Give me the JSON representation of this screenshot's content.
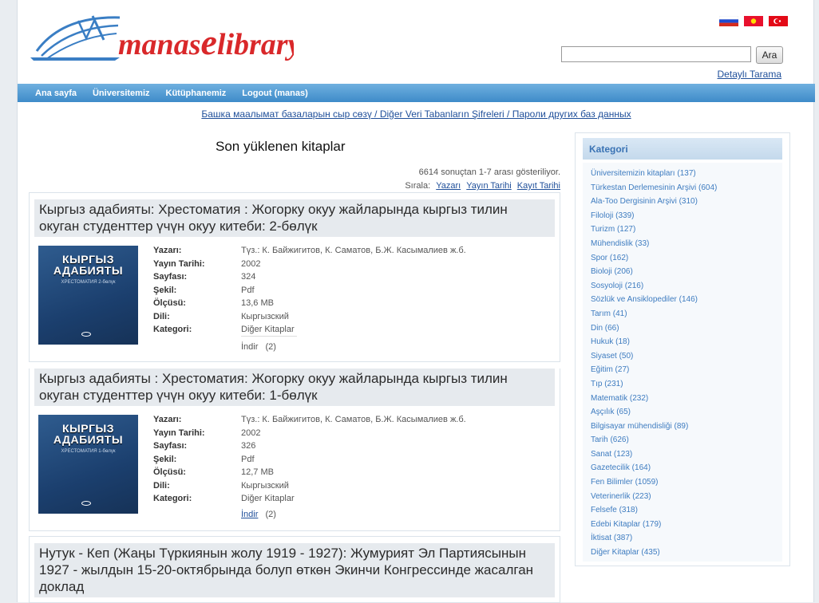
{
  "header": {
    "logo_word_a": "manas",
    "logo_word_b": "e",
    "logo_word_c": "library",
    "flags": [
      {
        "name": "russian-flag-icon",
        "colors": [
          "#ffffff",
          "#1f4bd1",
          "#d52b1e"
        ]
      },
      {
        "name": "kyrgyz-flag-icon",
        "colors": [
          "#e8112d",
          "#ffdf00"
        ]
      },
      {
        "name": "turkish-flag-icon",
        "colors": [
          "#e30a17",
          "#ffffff"
        ]
      }
    ],
    "search": {
      "value": "",
      "button": "Ara"
    },
    "advanced_search": "Detaylı Tarama"
  },
  "nav": {
    "items": [
      "Ana sayfa",
      "Üniversitemiz",
      "Kütüphanemiz",
      "Logout (manas)"
    ]
  },
  "db_link": "Башка маалымат базаларын сыр сөзү / Diğer Veri Tabanların Şifreleri / Пароли других баз данных",
  "main": {
    "section_title": "Son yüklenen kitaplar",
    "results_summary": "6614 sonuçtan 1-7 arası gösteriliyor.",
    "sort_label": "Sırala:",
    "sort_options": [
      "Yazarı",
      "Yayın Tarihi",
      "Kayıt Tarihi"
    ],
    "labels": {
      "author": "Yazarı:",
      "year": "Yayın Tarihi:",
      "pages": "Sayfası:",
      "format": "Şekil:",
      "size": "Ölçüsü:",
      "language": "Dili:",
      "category": "Kategori:"
    },
    "books": [
      {
        "title": "Кыргыз адабияты: Хрестоматия : Жогорку окуу жайларында кыргыз тилин окуган студенттер үчүн окуу китеби: 2-бөлүк",
        "cover_title": "КЫРГЫЗ АДАБИЯТЫ",
        "cover_subtitle": "ХРЕСТОМАТИЯ 2-бөлүк",
        "author": "Түз.: К. Байжигитов, К. Саматов, Б.Ж. Касымалиев ж.б.",
        "year": "2002",
        "pages": "324",
        "format": "Pdf",
        "size": "13,6 MB",
        "language": "Кыргызский",
        "category": "Diğer Kitaplar",
        "download_label": "İndir",
        "download_count": "(2)"
      },
      {
        "title": "Кыргыз адабияты : Хрестоматия: Жогорку окуу жайларында кыргыз тилин окуган студенттер үчүн окуу китеби: 1-бөлүк",
        "cover_title": "КЫРГЫЗ АДАБИЯТЫ",
        "cover_subtitle": "ХРЕСТОМАТИЯ 1-бөлүк",
        "author": "Түз.: К. Байжигитов, К. Саматов, Б.Ж. Касымалиев ж.б.",
        "year": "2002",
        "pages": "326",
        "format": "Pdf",
        "size": "12,7 MB",
        "language": "Кыргызский",
        "category": "Diğer Kitaplar",
        "download_label": "İndir",
        "download_count": "(2)"
      },
      {
        "title": "Нутук - Кеп (Жаңы Түркиянын жолу 1919 - 1927): Жумурият Эл Партиясынын 1927 - жылдын 15-20-октябрында болуп өткөн Экинчи Конгрессинде жасалган доклад"
      }
    ]
  },
  "sidebar": {
    "title": "Kategori",
    "categories": [
      "Üniversitemizin kitapları (137)",
      "Türkestan Derlemesinin Arşivi (604)",
      "Ala-Too Dergisinin Arşivi (310)",
      "Filoloji (339)",
      "Turizm (127)",
      "Mühendislik (33)",
      "Spor (162)",
      "Bioloji (206)",
      "Sosyoloji (216)",
      "Sözlük ve Ansiklopediler (146)",
      "Tarım (41)",
      "Din (66)",
      "Hukuk (18)",
      "Siyaset (50)",
      "Eğitim (27)",
      "Tıp (231)",
      "Matematik (232)",
      "Aşçılık (65)",
      "Bilgisayar mühendisliği (89)",
      "Tarih (626)",
      "Sanat (123)",
      "Gazetecilik (164)",
      "Fen Bilimler (1059)",
      "Veterinerlik (223)",
      "Felsefe (318)",
      "Edebi Kitaplar (179)",
      "İktisat (387)",
      "Diğer Kitaplar (435)"
    ]
  },
  "colors": {
    "nav_gradient_top": "#6fb0e0",
    "nav_gradient_bottom": "#3e8bc9",
    "logo_red": "#d9282a",
    "logo_blue": "#3a7ec4",
    "link_blue": "#1f4f9a"
  }
}
